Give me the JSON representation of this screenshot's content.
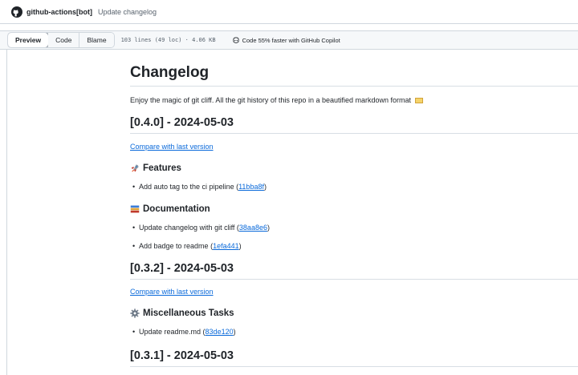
{
  "commit": {
    "author": "github-actions[bot]",
    "message": "Update changelog"
  },
  "toolbar": {
    "tabs": [
      "Preview",
      "Code",
      "Blame"
    ],
    "active_tab": "Preview",
    "file_meta": "103 lines (49 loc) · 4.06 KB",
    "copilot_text": "Code 55% faster with GitHub Copilot"
  },
  "doc": {
    "title": "Changelog",
    "intro": "Enjoy the magic of git cliff. All the git history of this repo in a beautified markdown format",
    "sections": [
      {
        "heading": "[0.4.0] - 2024-05-03",
        "compare": "Compare with last version",
        "groups": [
          {
            "icon": "rocket-icon",
            "title": "Features",
            "items": [
              {
                "text": "Add auto tag to the ci pipeline",
                "hash": "11bba8f"
              }
            ]
          },
          {
            "icon": "books-icon",
            "title": "Documentation",
            "items": [
              {
                "text": "Update changelog with git cliff",
                "hash": "38aa8e6"
              },
              {
                "text": "Add badge to readme",
                "hash": "1efa441"
              }
            ]
          }
        ]
      },
      {
        "heading": "[0.3.2] - 2024-05-03",
        "compare": "Compare with last version",
        "groups": [
          {
            "icon": "gear-icon",
            "title": "Miscellaneous Tasks",
            "items": [
              {
                "text": "Update readme.md",
                "hash": "83de120"
              }
            ]
          }
        ]
      },
      {
        "heading": "[0.3.1] - 2024-05-03"
      }
    ]
  },
  "colors": {
    "link": "#0969da",
    "border": "#d0d7de",
    "text": "#1f2328",
    "muted": "#59636e"
  }
}
